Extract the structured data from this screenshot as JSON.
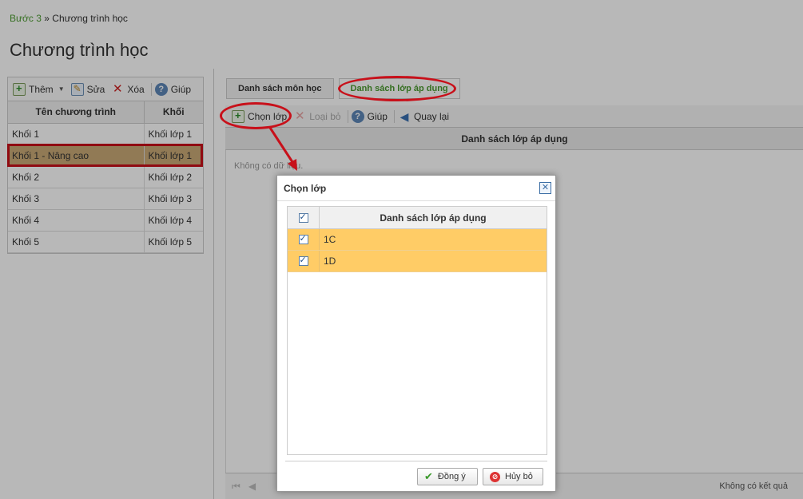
{
  "breadcrumb": {
    "step": "Bước 3",
    "separator": "»",
    "current": "Chương trình học"
  },
  "page_title": "Chương trình học",
  "left_toolbar": {
    "add": "Thêm",
    "edit": "Sửa",
    "delete": "Xóa",
    "help": "Giúp"
  },
  "left_table": {
    "headers": [
      "Tên chương trình",
      "Khối"
    ],
    "rows": [
      [
        "Khối 1",
        "Khối lớp 1"
      ],
      [
        "Khối 1 - Nâng cao",
        "Khối lớp 1"
      ],
      [
        "Khối 2",
        "Khối lớp 2"
      ],
      [
        "Khối 3",
        "Khối lớp 3"
      ],
      [
        "Khối 4",
        "Khối lớp 4"
      ],
      [
        "Khối 5",
        "Khối lớp 5"
      ]
    ],
    "selected_index": 1
  },
  "tabs": [
    "Danh sách môn học",
    "Danh sách lớp áp dụng"
  ],
  "active_tab": 1,
  "right_toolbar": {
    "choose": "Chọn lớp",
    "remove": "Loại bỏ",
    "help": "Giúp",
    "back": "Quay lại"
  },
  "right_grid": {
    "header": "Danh sách lớp áp dụng",
    "empty": "Không có dữ liệu."
  },
  "pager": {
    "status": "Không có kết quả"
  },
  "dialog": {
    "title": "Chọn lớp",
    "grid_header": "Danh sách lớp áp dụng",
    "rows": [
      "1C",
      "1D"
    ],
    "ok": "Đồng ý",
    "cancel": "Hủy bỏ"
  },
  "colors": {
    "annotation_red": "#c8101a",
    "selected_row": "#ffcc66",
    "active_tab_text": "#4a9a2e"
  }
}
